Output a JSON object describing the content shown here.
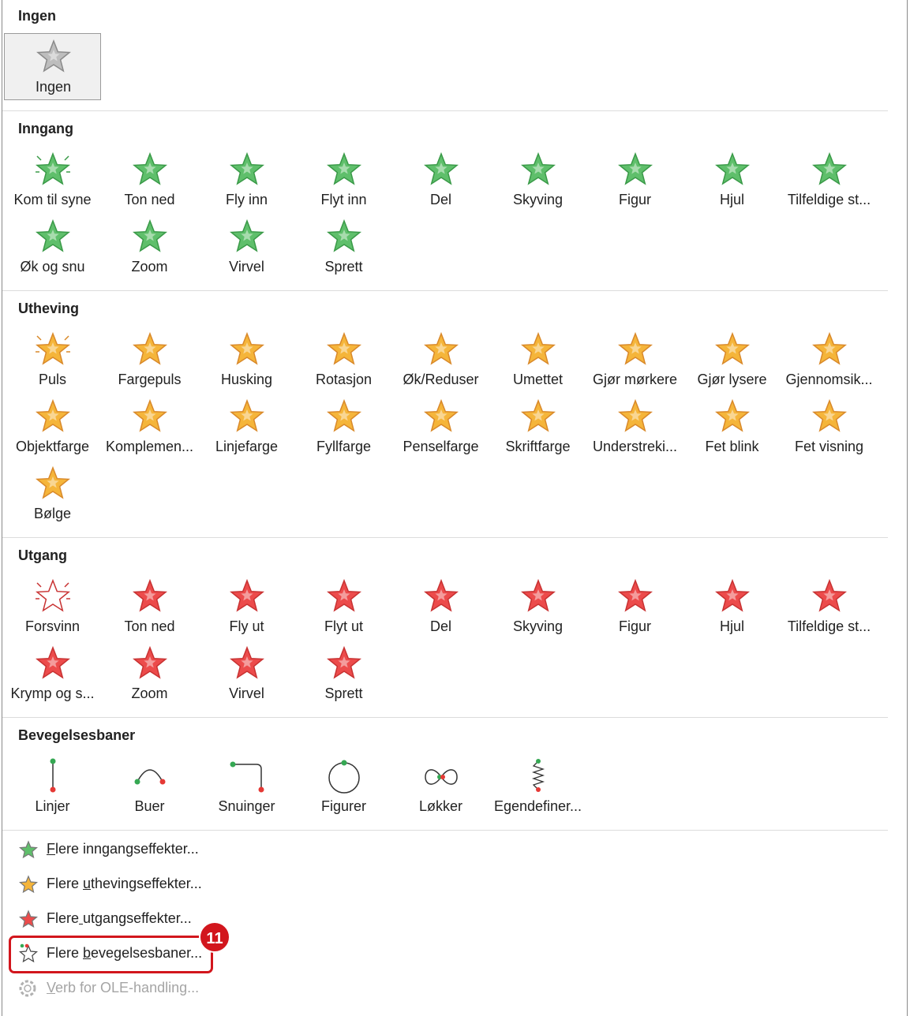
{
  "colors": {
    "entrance": "#5fbf6b",
    "emphasis": "#f5b53a",
    "exit": "#ec4b4b",
    "callout": "#d2161d",
    "disabled_text": "#a5a5a5"
  },
  "sections": [
    {
      "title": "Ingen",
      "kind": "none",
      "items": [
        {
          "label": "Ingen",
          "icon": "gray-star-icon",
          "selected": true
        }
      ]
    },
    {
      "title": "Inngang",
      "kind": "entrance",
      "items": [
        {
          "label": "Kom til syne",
          "icon": "star-burst-icon"
        },
        {
          "label": "Ton ned",
          "icon": "star-fade-icon"
        },
        {
          "label": "Fly inn",
          "icon": "star-fly-in-icon"
        },
        {
          "label": "Flyt inn",
          "icon": "star-float-in-icon"
        },
        {
          "label": "Del",
          "icon": "star-split-icon"
        },
        {
          "label": "Skyving",
          "icon": "star-wipe-icon"
        },
        {
          "label": "Figur",
          "icon": "star-shape-icon"
        },
        {
          "label": "Hjul",
          "icon": "star-wheel-icon"
        },
        {
          "label": "Tilfeldige st...",
          "icon": "star-random-bars-icon"
        },
        {
          "label": "Øk og snu",
          "icon": "star-grow-turn-icon"
        },
        {
          "label": "Zoom",
          "icon": "star-zoom-icon"
        },
        {
          "label": "Virvel",
          "icon": "star-swivel-icon"
        },
        {
          "label": "Sprett",
          "icon": "star-bounce-icon"
        }
      ]
    },
    {
      "title": "Utheving",
      "kind": "emphasis",
      "items": [
        {
          "label": "Puls",
          "icon": "star-pulse-icon"
        },
        {
          "label": "Fargepuls",
          "icon": "star-color-pulse-icon"
        },
        {
          "label": "Husking",
          "icon": "star-teeter-icon"
        },
        {
          "label": "Rotasjon",
          "icon": "star-spin-icon"
        },
        {
          "label": "Øk/Reduser",
          "icon": "star-grow-shrink-icon"
        },
        {
          "label": "Umettet",
          "icon": "star-desaturate-icon"
        },
        {
          "label": "Gjør mørkere",
          "icon": "star-darken-icon"
        },
        {
          "label": "Gjør lysere",
          "icon": "star-lighten-icon"
        },
        {
          "label": "Gjennomsik...",
          "icon": "star-transparency-icon"
        },
        {
          "label": "Objektfarge",
          "icon": "star-object-color-icon"
        },
        {
          "label": "Komplemen...",
          "icon": "star-complementary-icon"
        },
        {
          "label": "Linjefarge",
          "icon": "star-line-color-icon"
        },
        {
          "label": "Fyllfarge",
          "icon": "star-fill-color-icon"
        },
        {
          "label": "Penselfarge",
          "icon": "star-brush-color-icon"
        },
        {
          "label": "Skriftfarge",
          "icon": "star-font-color-icon"
        },
        {
          "label": "Understreki...",
          "icon": "star-underline-icon"
        },
        {
          "label": "Fet blink",
          "icon": "star-bold-flash-icon"
        },
        {
          "label": "Fet visning",
          "icon": "star-bold-reveal-icon"
        },
        {
          "label": "Bølge",
          "icon": "star-wave-icon"
        }
      ]
    },
    {
      "title": "Utgang",
      "kind": "exit",
      "items": [
        {
          "label": "Forsvinn",
          "icon": "star-disappear-icon"
        },
        {
          "label": "Ton ned",
          "icon": "star-fade-icon"
        },
        {
          "label": "Fly ut",
          "icon": "star-fly-out-icon"
        },
        {
          "label": "Flyt ut",
          "icon": "star-float-out-icon"
        },
        {
          "label": "Del",
          "icon": "star-split-icon"
        },
        {
          "label": "Skyving",
          "icon": "star-wipe-icon"
        },
        {
          "label": "Figur",
          "icon": "star-shape-icon"
        },
        {
          "label": "Hjul",
          "icon": "star-wheel-icon"
        },
        {
          "label": "Tilfeldige st...",
          "icon": "star-random-bars-icon"
        },
        {
          "label": "Krymp og s...",
          "icon": "star-shrink-turn-icon"
        },
        {
          "label": "Zoom",
          "icon": "star-zoom-icon"
        },
        {
          "label": "Virvel",
          "icon": "star-swivel-icon"
        },
        {
          "label": "Sprett",
          "icon": "star-bounce-icon"
        }
      ]
    },
    {
      "title": "Bevegelsesbaner",
      "kind": "motion",
      "items": [
        {
          "label": "Linjer",
          "icon": "path-line-icon"
        },
        {
          "label": "Buer",
          "icon": "path-arc-icon"
        },
        {
          "label": "Snuinger",
          "icon": "path-turn-icon"
        },
        {
          "label": "Figurer",
          "icon": "path-circle-icon"
        },
        {
          "label": "Løkker",
          "icon": "path-loop-icon"
        },
        {
          "label": "Egendefiner...",
          "icon": "path-custom-icon"
        }
      ]
    }
  ],
  "menu": [
    {
      "pre": "",
      "key": "F",
      "post": "lere inngangseffekter...",
      "icon": "entrance-star-icon",
      "disabled": false
    },
    {
      "pre": "Flere ",
      "key": "u",
      "post": "thevingseffekter...",
      "icon": "emphasis-star-icon",
      "disabled": false
    },
    {
      "pre": "Flere",
      "key": " ",
      "post": "utgangseffekter...",
      "icon": "exit-star-icon",
      "disabled": false
    },
    {
      "pre": "Flere ",
      "key": "b",
      "post": "evegelsesbaner...",
      "icon": "motion-path-star-icon",
      "disabled": false
    },
    {
      "pre": "",
      "key": "V",
      "post": "erb for OLE-handling...",
      "icon": "gear-icon",
      "disabled": true
    }
  ],
  "callout": {
    "number": "11"
  }
}
